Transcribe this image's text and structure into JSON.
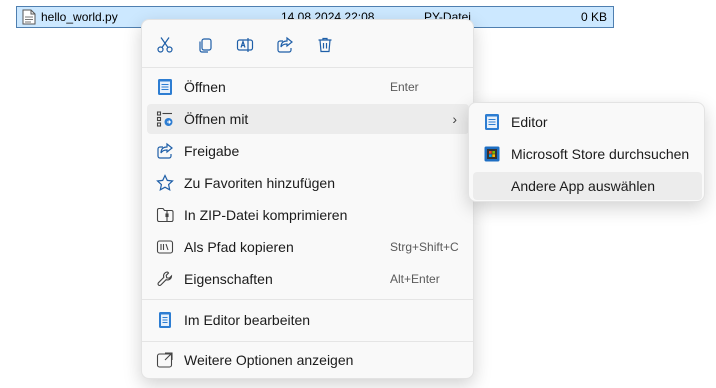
{
  "file_row": {
    "name": "hello_world.py",
    "date": "14.08.2024 22:08",
    "type": "PY-Datei",
    "size": "0 KB",
    "icon": "text-file-icon"
  },
  "quick_actions": [
    {
      "name": "cut",
      "icon": "scissors-icon"
    },
    {
      "name": "copy",
      "icon": "copy-icon"
    },
    {
      "name": "rename",
      "icon": "rename-icon"
    },
    {
      "name": "share",
      "icon": "share-icon"
    },
    {
      "name": "delete",
      "icon": "trash-icon"
    }
  ],
  "menu": {
    "items": [
      {
        "label": "Öffnen",
        "shortcut": "Enter",
        "icon": "notepad-icon"
      },
      {
        "label": "Öffnen mit",
        "shortcut": "",
        "icon": "open-with-icon",
        "submenu_arrow": "›"
      },
      {
        "label": "Freigabe",
        "shortcut": "",
        "icon": "share-icon"
      },
      {
        "label": "Zu Favoriten hinzufügen",
        "shortcut": "",
        "icon": "star-icon"
      },
      {
        "label": "In ZIP-Datei komprimieren",
        "shortcut": "",
        "icon": "zip-folder-icon"
      },
      {
        "label": "Als Pfad kopieren",
        "shortcut": "Strg+Shift+C",
        "icon": "path-icon"
      },
      {
        "label": "Eigenschaften",
        "shortcut": "Alt+Enter",
        "icon": "wrench-icon"
      },
      {
        "label": "Im Editor bearbeiten",
        "shortcut": "",
        "icon": "notepad-icon"
      },
      {
        "label": "Weitere Optionen anzeigen",
        "shortcut": "",
        "icon": "more-options-icon"
      }
    ]
  },
  "submenu": {
    "items": [
      {
        "label": "Editor",
        "icon": "notepad-icon"
      },
      {
        "label": "Microsoft Store durchsuchen",
        "icon": "store-icon"
      },
      {
        "label": "Andere App auswählen",
        "icon": ""
      }
    ]
  },
  "colors": {
    "accent": "#0067c0",
    "selection": "#cce8ff",
    "menu_bg": "#f9f9f9",
    "hover": "#ececec"
  }
}
